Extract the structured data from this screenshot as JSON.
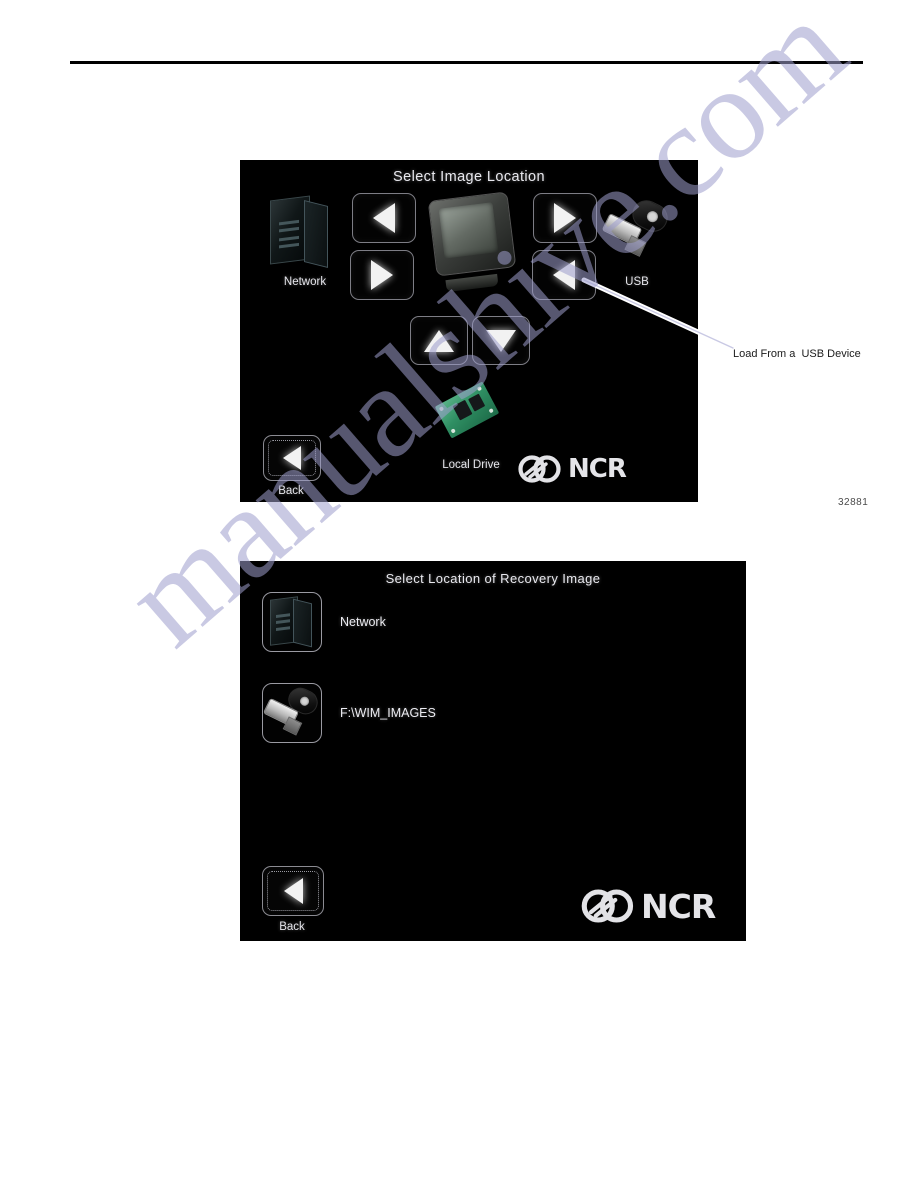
{
  "page": {
    "background": "#ffffff",
    "rule_color": "#000000",
    "watermark": "manualshive.com",
    "watermark_color": "#9e9ecd"
  },
  "figure_one": {
    "title": "Select Image Location",
    "figure_number": "32881",
    "devices": [
      {
        "name": "network-device",
        "label": "Network"
      },
      {
        "name": "pos-terminal-device",
        "label": ""
      },
      {
        "name": "usb-device",
        "label": "USB"
      },
      {
        "name": "local-drive-device",
        "label": "Local Drive"
      }
    ],
    "nav_buttons": [
      {
        "name": "scroll-left-button",
        "glyph": "triangle-left-icon"
      },
      {
        "name": "scroll-left-lower-button",
        "glyph": "triangle-right-icon"
      },
      {
        "name": "scroll-right-button",
        "glyph": "triangle-right-icon"
      },
      {
        "name": "select-usb-button",
        "glyph": "triangle-left-icon"
      },
      {
        "name": "scroll-up-button",
        "glyph": "triangle-up-icon"
      },
      {
        "name": "scroll-down-button",
        "glyph": "triangle-down-icon"
      }
    ],
    "back_label": "Back",
    "brand": "NCR",
    "callout": "Load From a  USB Device"
  },
  "figure_two": {
    "title": "Select Location of Recovery Image",
    "rows": [
      {
        "name": "network-row",
        "icon": "network-icon",
        "label": "Network"
      },
      {
        "name": "usb-path-row",
        "icon": "usb-icon",
        "label": "F:\\WIM_IMAGES"
      }
    ],
    "back_label": "Back",
    "brand": "NCR"
  }
}
